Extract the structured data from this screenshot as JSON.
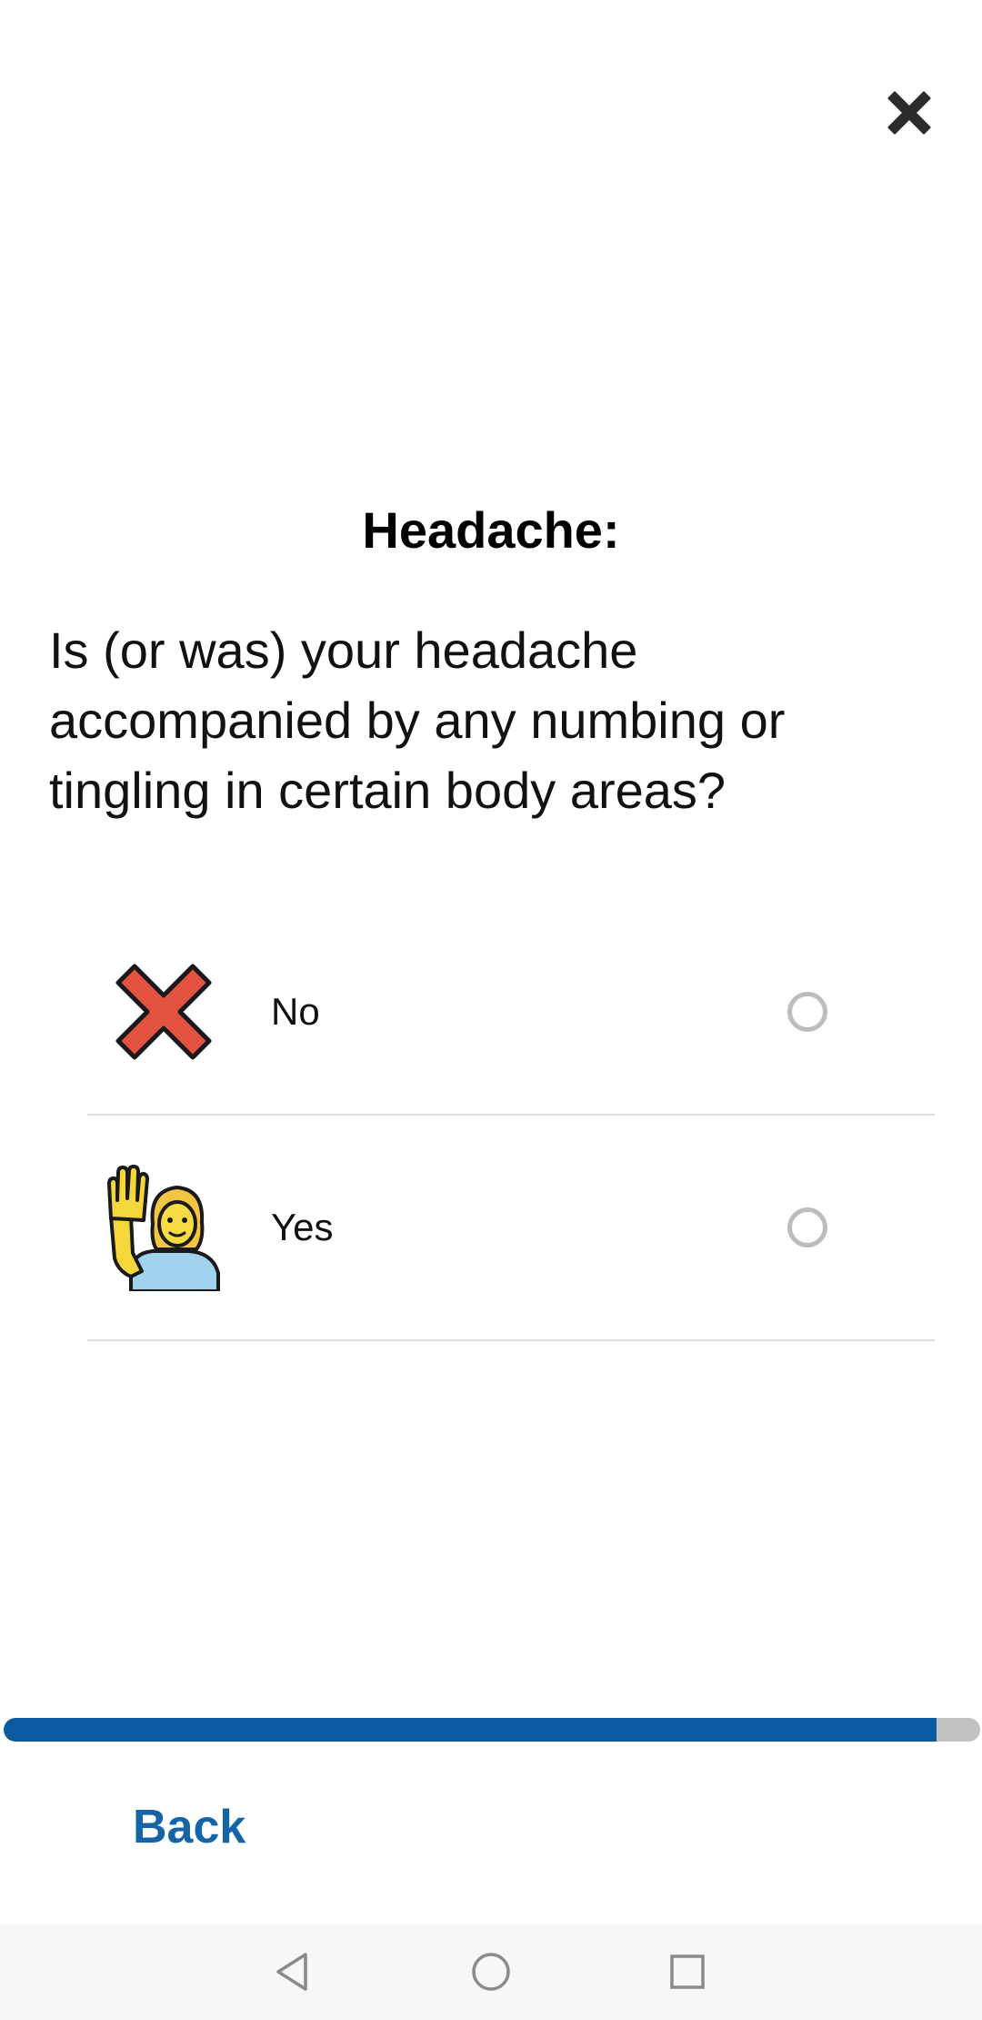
{
  "header": {
    "close_icon": "close-x-icon"
  },
  "section": {
    "title": "Headache:"
  },
  "question": {
    "text": "Is (or was) your headache accompanied by any numbing or tingling in certain body areas?"
  },
  "options": [
    {
      "label": "No",
      "icon": "red-cross-icon",
      "selected": false
    },
    {
      "label": "Yes",
      "icon": "person-raising-hand-icon",
      "selected": false
    }
  ],
  "progress": {
    "fraction": 0.955,
    "fill_color": "#0b5aa1",
    "track_color": "#c2c2c2"
  },
  "footer": {
    "back_label": "Back"
  },
  "system_nav": {
    "back_icon": "nav-back-triangle-icon",
    "home_icon": "nav-home-circle-icon",
    "recents_icon": "nav-recents-square-icon"
  }
}
